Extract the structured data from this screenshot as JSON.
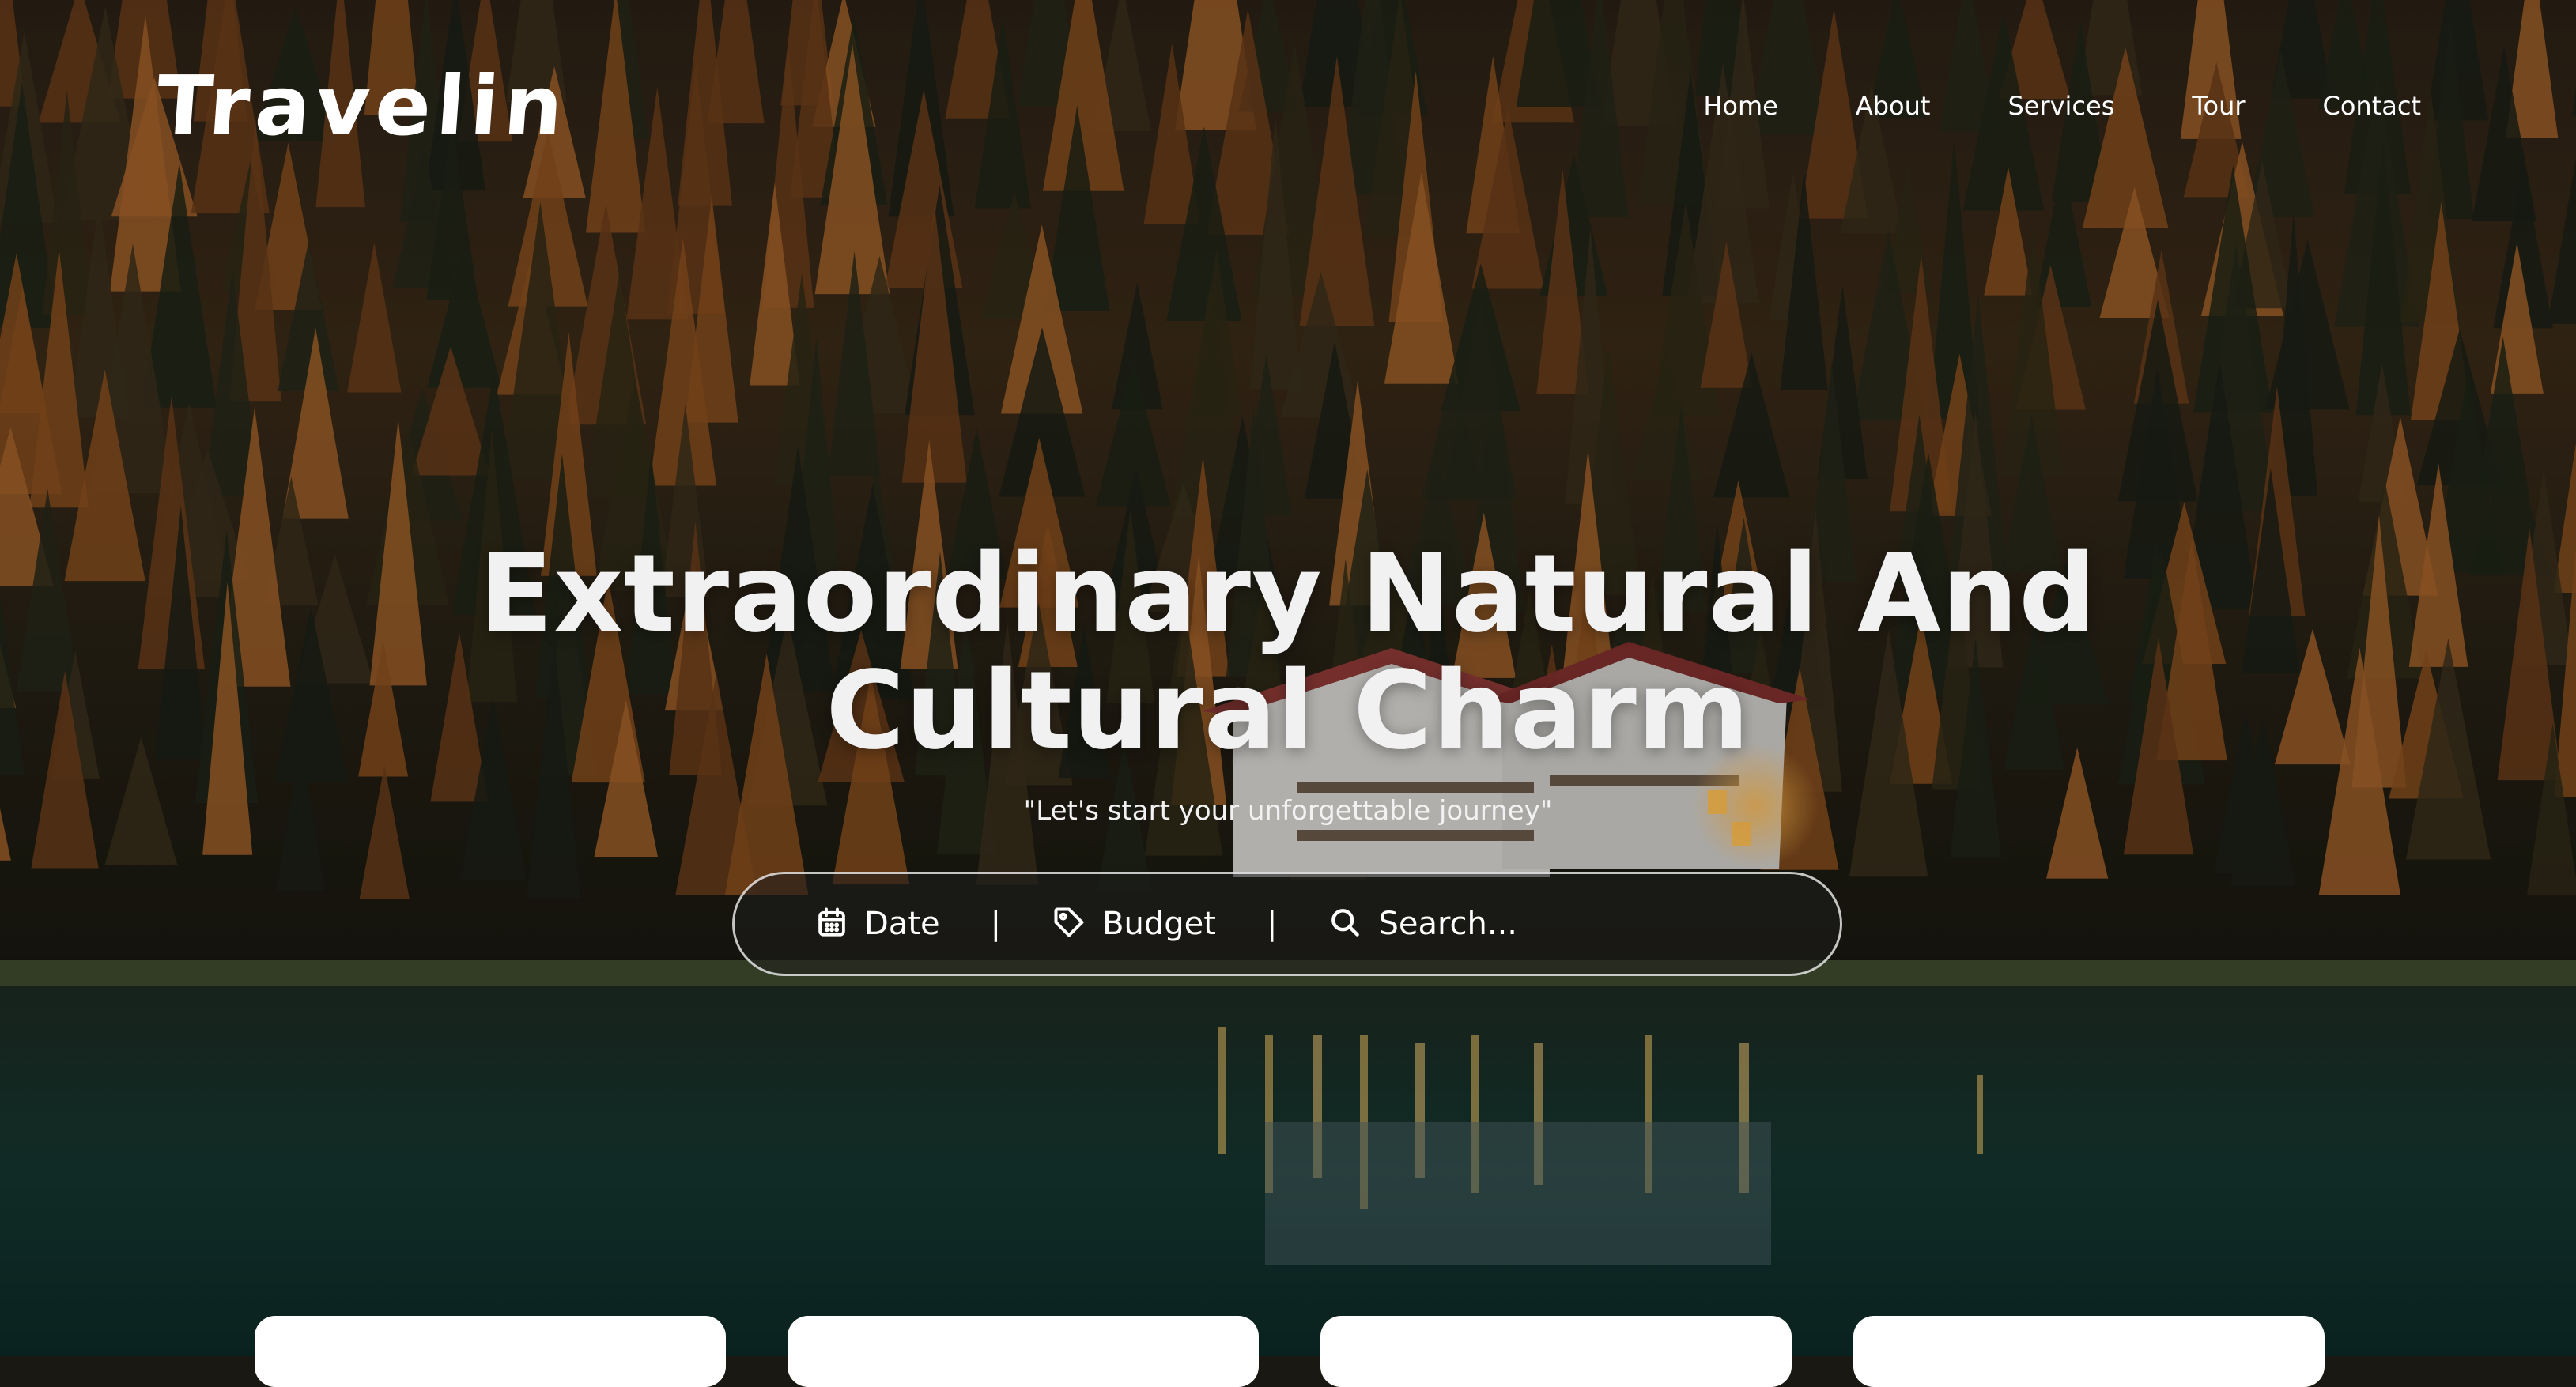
{
  "brand": {
    "logo": "Travelin"
  },
  "nav": {
    "items": [
      "Home",
      "About",
      "Services",
      "Tour",
      "Contact"
    ]
  },
  "hero": {
    "title_line1": "Extraordinary Natural And",
    "title_line2": "Cultural Charm",
    "subtitle": "\"Let's start your unforgettable journey\""
  },
  "search_bar": {
    "date_label": "Date",
    "budget_label": "Budget",
    "separator": "|",
    "search_placeholder": "Search...",
    "icons": [
      "calendar-icon",
      "tag-icon",
      "search-icon"
    ]
  },
  "cards": {
    "count_visible": 4
  },
  "colors": {
    "text": "#ffffff",
    "card_bg": "#ffffff"
  }
}
